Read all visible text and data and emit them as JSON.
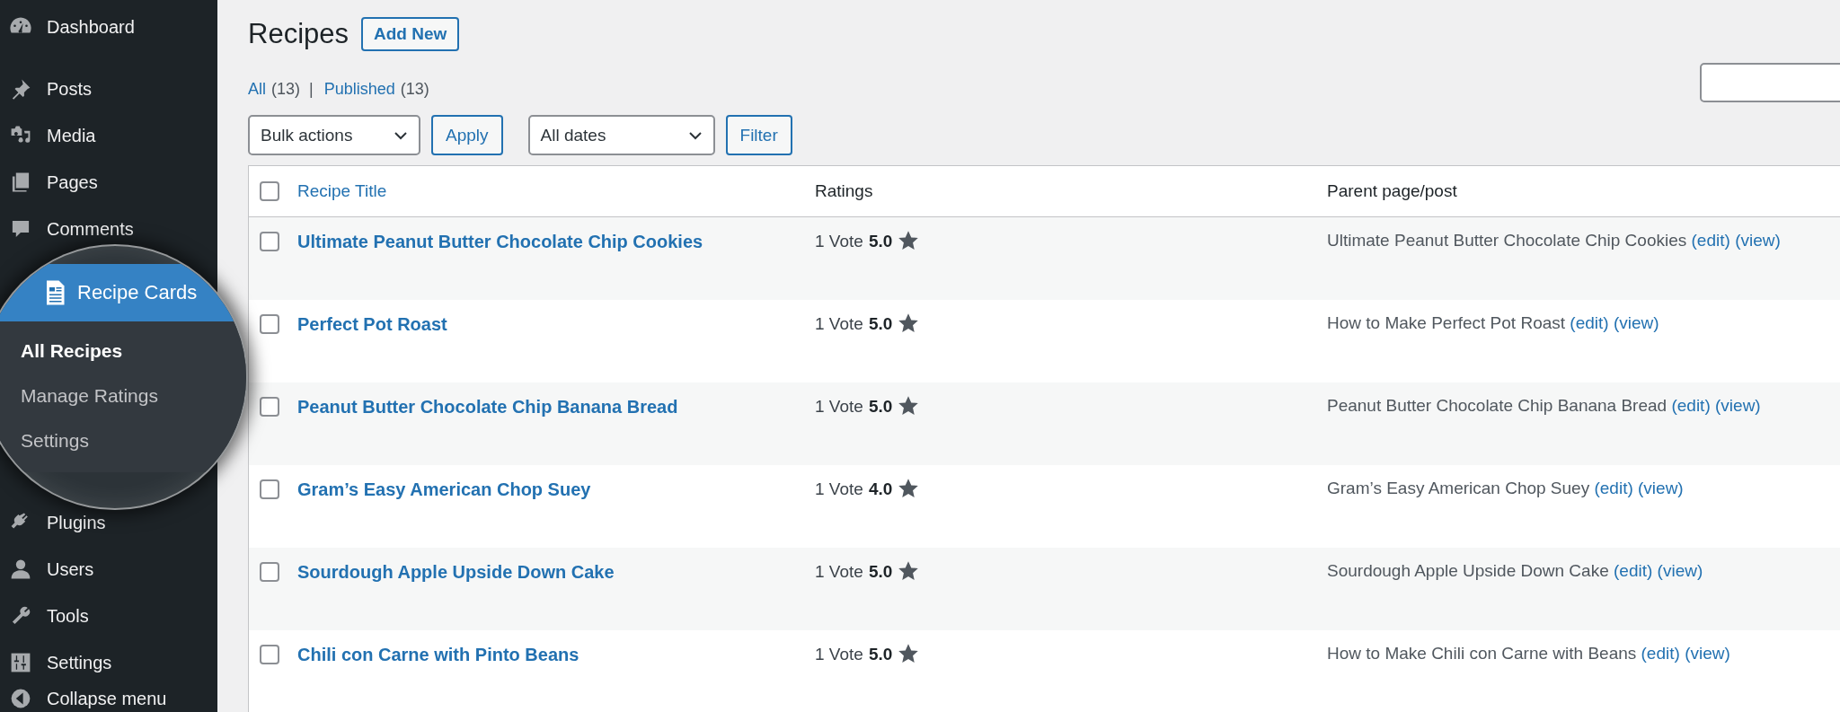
{
  "sidebar": {
    "items": [
      {
        "label": "Dashboard",
        "selected": false
      },
      {
        "label": "Posts",
        "selected": false
      },
      {
        "label": "Media",
        "selected": false
      },
      {
        "label": "Pages",
        "selected": false
      },
      {
        "label": "Comments",
        "selected": false
      },
      {
        "label": "Recipe Cards",
        "selected": true,
        "children": [
          {
            "label": "All Recipes",
            "selected": true
          },
          {
            "label": "Manage Ratings",
            "selected": false
          },
          {
            "label": "Settings",
            "selected": false
          }
        ]
      },
      {
        "label": "Plugins",
        "selected": false
      },
      {
        "label": "Users",
        "selected": false
      },
      {
        "label": "Tools",
        "selected": false
      },
      {
        "label": "Settings",
        "selected": false
      },
      {
        "label": "Collapse menu",
        "selected": false
      }
    ]
  },
  "page": {
    "title": "Recipes",
    "add_button": "Add New"
  },
  "views": [
    {
      "label": "All",
      "count": "(13)"
    },
    {
      "label": "Published",
      "count": "(13)"
    }
  ],
  "views_separator": "|",
  "toolbar": {
    "bulk_select": "Bulk actions",
    "apply_button": "Apply",
    "date_select": "All dates",
    "filter_button": "Filter"
  },
  "table": {
    "select_all_checked": false,
    "columns": [
      {
        "label": "Recipe Title",
        "sortable": true
      },
      {
        "label": "Ratings",
        "sortable": false
      },
      {
        "label": "Parent page/post",
        "sortable": false
      }
    ],
    "rows": [
      {
        "checked": false,
        "title": "Ultimate Peanut Butter Chocolate Chip Cookies",
        "votes": "1 Vote",
        "score": "5.0",
        "parent": "Ultimate Peanut Butter Chocolate Chip Cookies",
        "edit": "(edit)",
        "view": "(view)"
      },
      {
        "checked": false,
        "title": "Perfect Pot Roast",
        "votes": "1 Vote",
        "score": "5.0",
        "parent": "How to Make Perfect Pot Roast",
        "edit": "(edit)",
        "view": "(view)"
      },
      {
        "checked": false,
        "title": "Peanut Butter Chocolate Chip Banana Bread",
        "votes": "1 Vote",
        "score": "5.0",
        "parent": "Peanut Butter Chocolate Chip Banana Bread",
        "edit": "(edit)",
        "view": "(view)"
      },
      {
        "checked": false,
        "title": "Gram’s Easy American Chop Suey",
        "votes": "1 Vote",
        "score": "4.0",
        "parent": "Gram’s Easy American Chop Suey",
        "edit": "(edit)",
        "view": "(view)"
      },
      {
        "checked": false,
        "title": "Sourdough Apple Upside Down Cake",
        "votes": "1 Vote",
        "score": "5.0",
        "parent": "Sourdough Apple Upside Down Cake",
        "edit": "(edit)",
        "view": "(view)"
      },
      {
        "checked": false,
        "title": "Chili con Carne with Pinto Beans",
        "votes": "1 Vote",
        "score": "5.0",
        "parent": "How to Make Chili con Carne with Beans",
        "edit": "(edit)",
        "view": "(view)"
      }
    ]
  }
}
